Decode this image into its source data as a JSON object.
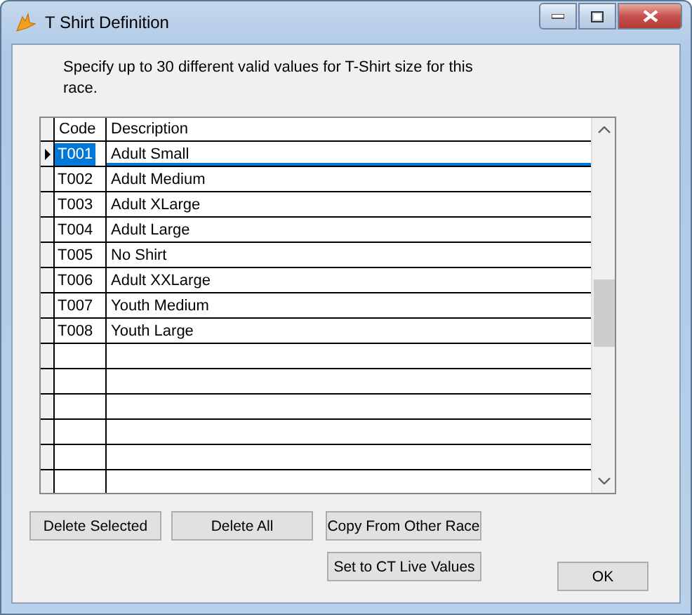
{
  "window": {
    "title": "T Shirt Definition"
  },
  "instructions": "Specify up to 30 different valid values for T-Shirt size for this race.",
  "table": {
    "columns": [
      "Code",
      "Description"
    ],
    "rows": [
      {
        "code": "T001",
        "description": "Adult Small",
        "selected": true
      },
      {
        "code": "T002",
        "description": "Adult Medium",
        "selected": false
      },
      {
        "code": "T003",
        "description": "Adult XLarge",
        "selected": false
      },
      {
        "code": "T004",
        "description": "Adult Large",
        "selected": false
      },
      {
        "code": "T005",
        "description": "No Shirt",
        "selected": false
      },
      {
        "code": "T006",
        "description": "Adult XXLarge",
        "selected": false
      },
      {
        "code": "T007",
        "description": "Youth Medium",
        "selected": false
      },
      {
        "code": "T008",
        "description": "Youth Large",
        "selected": false
      }
    ]
  },
  "buttons": {
    "delete_selected": "Delete Selected",
    "delete_all": "Delete All",
    "copy_from_other_race": "Copy From Other Race",
    "set_to_ct_live_values": "Set to CT Live Values",
    "ok": "OK"
  }
}
